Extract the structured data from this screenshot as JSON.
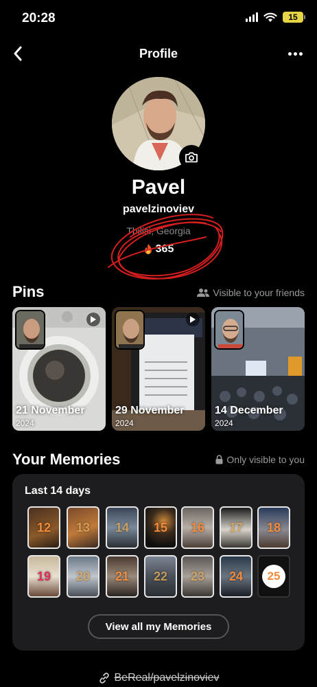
{
  "status": {
    "time": "20:28",
    "battery": "15"
  },
  "nav": {
    "title": "Profile"
  },
  "profile": {
    "name": "Pavel",
    "username": "pavelzinoviev",
    "location": "Tbilisi, Georgia",
    "streak": "365"
  },
  "pins": {
    "title": "Pins",
    "visibility": "Visible to your friends",
    "items": [
      {
        "date": "21 November",
        "year": "2024"
      },
      {
        "date": "29 November",
        "year": "2024"
      },
      {
        "date": "14 December",
        "year": "2024"
      }
    ]
  },
  "memories": {
    "title": "Your Memories",
    "visibility": "Only visible to you",
    "period": "Last 14 days",
    "days": [
      "12",
      "13",
      "14",
      "15",
      "16",
      "17",
      "18",
      "19",
      "20",
      "21",
      "22",
      "23",
      "24"
    ],
    "today": "25",
    "view_all_label": "View all my Memories"
  },
  "footer": {
    "link": "BeReal/pavelzinoviev"
  },
  "colors": {
    "accent": "#f48a3a",
    "annotation": "#d61e1e",
    "card": "#1d1d1f"
  }
}
